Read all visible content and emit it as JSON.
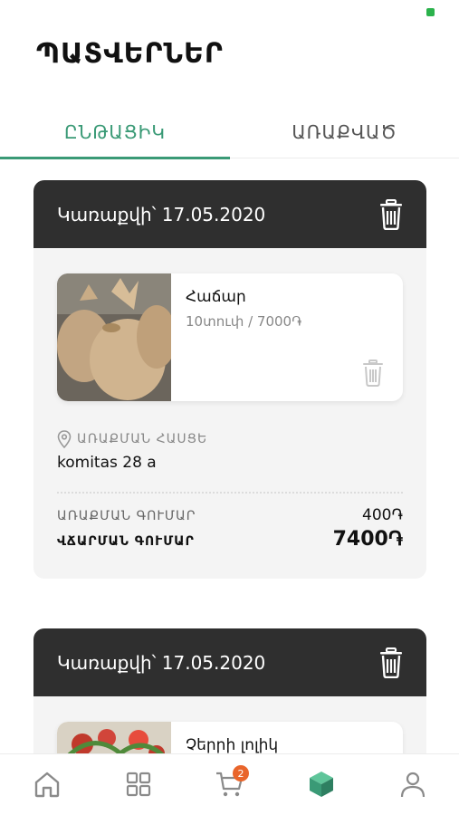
{
  "page_title": "ՊԱՏՎԵՐՆԵՐ",
  "tabs": [
    {
      "label": "ԸՆԹԱՑԻԿ",
      "active": true
    },
    {
      "label": "ԱՌԱՔՎԱԾ",
      "active": false
    }
  ],
  "orders": [
    {
      "header": "Կառաքվի՝ 17.05.2020",
      "item": {
        "name": "Հաճար",
        "desc": "10տուփ / 7000֏"
      },
      "address_label": "ԱՌԱՔՄԱՆ ՀԱՍՑԵ",
      "address": "komitas 28 a",
      "delivery_label": "ԱՌԱՔՄԱՆ ԳՈՒՄԱՐ",
      "delivery_value": "400֏",
      "total_label": "ՎՃԱՐՄԱՆ ԳՈՒՄԱՐ",
      "total_value": "7400֏"
    },
    {
      "header": "Կառաքվի՝ 17.05.2020",
      "item": {
        "name": "Չերրի լոլիկ"
      }
    }
  ],
  "nav": {
    "cart_badge": "2",
    "active_color": "#3a9a76"
  },
  "icons": [
    "home-icon",
    "grid-icon",
    "cart-icon",
    "box-icon",
    "profile-icon",
    "trash-icon",
    "location-pin-icon"
  ]
}
